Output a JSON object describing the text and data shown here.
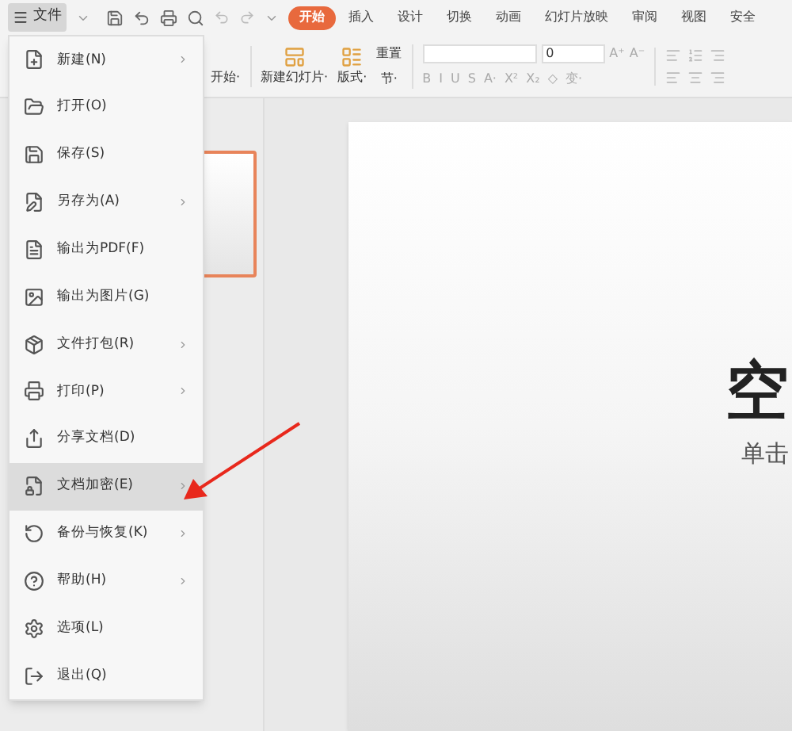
{
  "menu_button": {
    "label": "文件"
  },
  "tabs": [
    {
      "label": "开始",
      "selected": true
    },
    {
      "label": "插入",
      "selected": false
    },
    {
      "label": "设计",
      "selected": false
    },
    {
      "label": "切换",
      "selected": false
    },
    {
      "label": "动画",
      "selected": false
    },
    {
      "label": "幻灯片放映",
      "selected": false
    },
    {
      "label": "审阅",
      "selected": false
    },
    {
      "label": "视图",
      "selected": false
    },
    {
      "label": "安全",
      "selected": false
    }
  ],
  "ribbon": {
    "partial_button": "开始·",
    "new_slide": "新建幻灯片·",
    "layout": "版式·",
    "reset": "重置",
    "section": "节·",
    "font_size": "0",
    "size_buttons": [
      "A⁺",
      "A⁻"
    ],
    "format_buttons": [
      "B",
      "I",
      "U",
      "S",
      "A·",
      "X²",
      "X₂",
      "◇",
      "变·"
    ]
  },
  "file_menu": [
    {
      "label": "新建(N)",
      "submenu": true,
      "selected": false
    },
    {
      "label": "打开(O)",
      "submenu": false,
      "selected": false
    },
    {
      "label": "保存(S)",
      "submenu": false,
      "selected": false
    },
    {
      "label": "另存为(A)",
      "submenu": true,
      "selected": false
    },
    {
      "label": "输出为PDF(F)",
      "submenu": false,
      "selected": false
    },
    {
      "label": "输出为图片(G)",
      "submenu": false,
      "selected": false
    },
    {
      "label": "文件打包(R)",
      "submenu": true,
      "selected": false
    },
    {
      "label": "打印(P)",
      "submenu": true,
      "selected": false
    },
    {
      "label": "分享文档(D)",
      "submenu": false,
      "selected": false
    },
    {
      "label": "文档加密(E)",
      "submenu": true,
      "selected": true
    },
    {
      "label": "备份与恢复(K)",
      "submenu": true,
      "selected": false
    },
    {
      "label": "帮助(H)",
      "submenu": true,
      "selected": false
    },
    {
      "label": "选项(L)",
      "submenu": false,
      "selected": false
    },
    {
      "label": "退出(Q)",
      "submenu": false,
      "selected": false
    }
  ],
  "slide": {
    "title": "空",
    "subtitle": "单击"
  }
}
